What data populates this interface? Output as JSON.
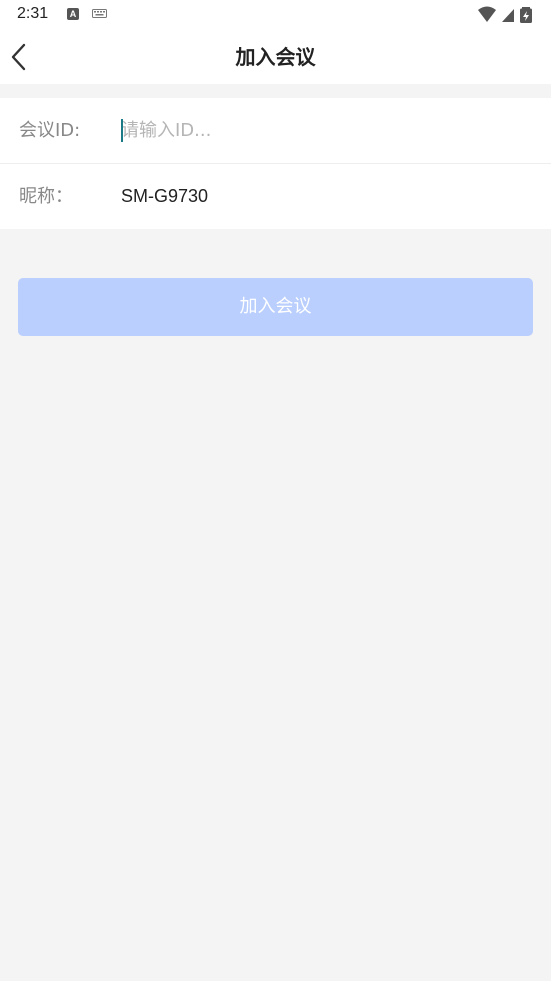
{
  "status_bar": {
    "time": "2:31",
    "icons": [
      "text-a-icon",
      "keyboard-icon",
      "wifi-icon",
      "signal-icon",
      "battery-charging-icon"
    ]
  },
  "header": {
    "title": "加入会议",
    "back_icon": "chevron-left-icon"
  },
  "form": {
    "meeting_id": {
      "label": "会议ID:",
      "value": "",
      "placeholder": "请输入ID..."
    },
    "nickname": {
      "label": "昵称：",
      "value": "SM-G9730"
    }
  },
  "join_button": {
    "label": "加入会议",
    "enabled": false
  },
  "colors": {
    "background": "#f4f4f4",
    "surface": "#ffffff",
    "button_disabled": "#bacffd",
    "caret": "#1a7a86"
  }
}
